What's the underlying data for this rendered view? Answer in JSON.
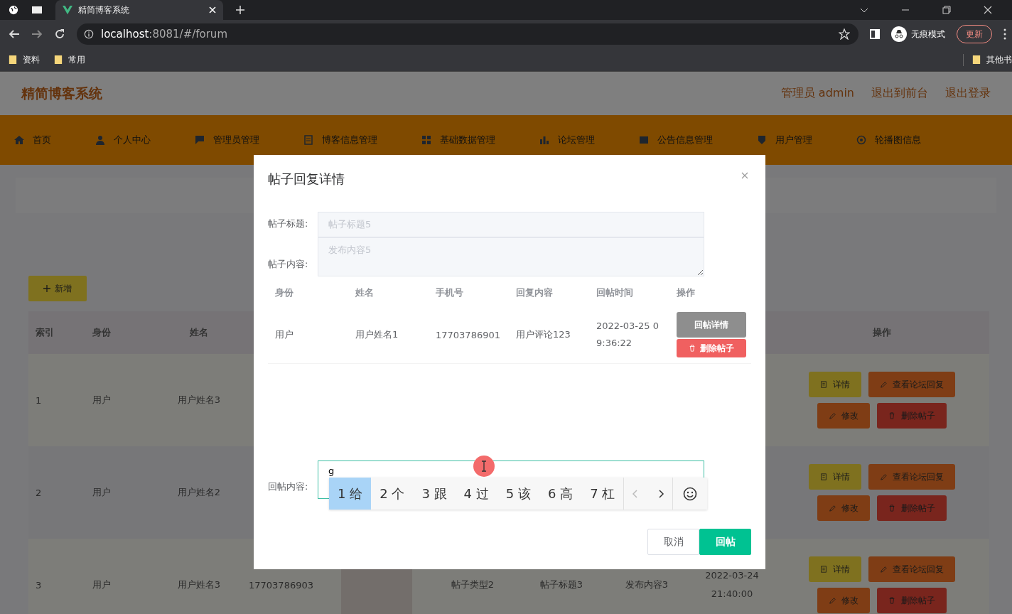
{
  "browser": {
    "tab_title": "精简博客系统",
    "url_host": "localhost",
    "url_path": ":8081/#/forum",
    "profile_label": "无痕模式",
    "update_label": "更新",
    "bookmarks": [
      {
        "label": "资料"
      },
      {
        "label": "常用"
      }
    ],
    "other_bookmarks": "其他书"
  },
  "header": {
    "title": "精简博客系统",
    "links": [
      {
        "label": "管理员 admin"
      },
      {
        "label": "退出到前台"
      },
      {
        "label": "退出登录"
      }
    ]
  },
  "nav": [
    {
      "label": "首页"
    },
    {
      "label": "个人中心"
    },
    {
      "label": "管理员管理"
    },
    {
      "label": "博客信息管理"
    },
    {
      "label": "基础数据管理"
    },
    {
      "label": "论坛管理"
    },
    {
      "label": "公告信息管理"
    },
    {
      "label": "用户管理"
    },
    {
      "label": "轮播图信息"
    }
  ],
  "add_button": "新增",
  "table": {
    "columns": [
      "索引",
      "身份",
      "姓名",
      "操作"
    ],
    "rows": [
      {
        "index": "1",
        "role": "用户",
        "name": "用户姓名3",
        "actions": [
          {
            "label": "详情",
            "kind": "detail"
          },
          {
            "label": "查看论坛回复",
            "kind": "replies"
          },
          {
            "label": "修改",
            "kind": "edit"
          },
          {
            "label": "删除帖子",
            "kind": "delete"
          }
        ]
      },
      {
        "index": "2",
        "role": "用户",
        "name": "用户姓名2",
        "actions": [
          {
            "label": "详情",
            "kind": "detail"
          },
          {
            "label": "查看论坛回复",
            "kind": "replies"
          },
          {
            "label": "修改",
            "kind": "edit"
          },
          {
            "label": "删除帖子",
            "kind": "delete"
          }
        ]
      },
      {
        "index": "3",
        "role": "用户",
        "name": "用户姓名3",
        "phone": "17703786903",
        "photo": true,
        "type": "帖子类型2",
        "title": "帖子标题3",
        "content": "发布内容3",
        "time": "2022-03-24 21:40:00",
        "actions": [
          {
            "label": "详情",
            "kind": "detail"
          },
          {
            "label": "查看论坛回复",
            "kind": "replies"
          },
          {
            "label": "修改",
            "kind": "edit"
          },
          {
            "label": "删除帖子",
            "kind": "delete"
          }
        ]
      }
    ]
  },
  "dialog": {
    "title": "帖子回复详情",
    "fields": [
      {
        "label": "帖子标题:",
        "value": "帖子标题5",
        "kind": "input",
        "disabled": true
      },
      {
        "label": "帖子内容:",
        "value": "发布内容5",
        "kind": "textarea",
        "disabled": true
      }
    ],
    "replies": {
      "columns": [
        "身份",
        "姓名",
        "手机号",
        "回复内容",
        "回帖时间",
        "操作"
      ],
      "rows": [
        {
          "role": "用户",
          "name": "用户姓名1",
          "phone": "17703786901",
          "content": "用户评论123",
          "time": "2022-03-25 09:36:22",
          "actions": [
            {
              "label": "回帖详情",
              "kind": "detail"
            },
            {
              "label": "删除帖子",
              "kind": "delete"
            }
          ]
        }
      ]
    },
    "reply": {
      "label": "回帖内容:",
      "value": "g",
      "focused": true
    },
    "ime": [
      {
        "label": "1 给",
        "selected": true
      },
      {
        "label": "2 个",
        "selected": false
      },
      {
        "label": "3 跟",
        "selected": false
      },
      {
        "label": "4 过",
        "selected": false
      },
      {
        "label": "5 该",
        "selected": false
      },
      {
        "label": "6 高",
        "selected": false
      },
      {
        "label": "7 杠",
        "selected": false
      }
    ],
    "buttons": [
      {
        "label": "取消",
        "kind": "cancel"
      },
      {
        "label": "回帖",
        "kind": "primary"
      }
    ]
  }
}
